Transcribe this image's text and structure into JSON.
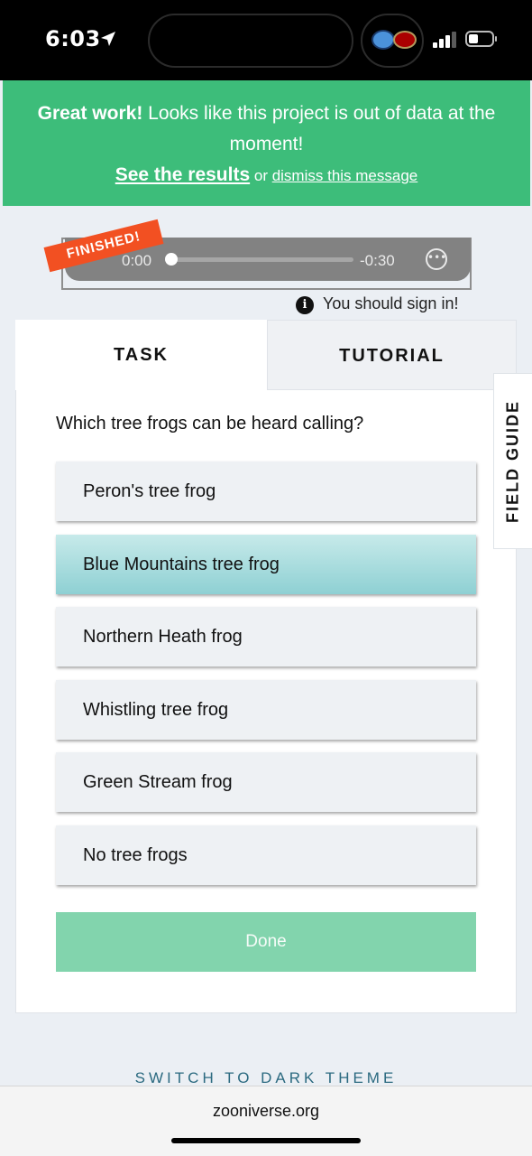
{
  "status_bar": {
    "time": "6:03"
  },
  "banner": {
    "bold_text": "Great work!",
    "message": " Looks like this project is out of data at the moment!",
    "results_link": "See the results",
    "or_text": " or ",
    "dismiss_link": "dismiss this message",
    "background_color": "#3dbd7a"
  },
  "audio_player": {
    "current_time": "0:00",
    "remaining_time": "-0:30",
    "progress": 0,
    "finished_badge": "FINISHED!"
  },
  "sign_in_notice": "You should sign in!",
  "tabs": [
    {
      "label": "TASK",
      "active": true
    },
    {
      "label": "TUTORIAL",
      "active": false
    }
  ],
  "task": {
    "question": "Which tree frogs can be heard calling?",
    "options": [
      {
        "label": "Peron's tree frog",
        "selected": false
      },
      {
        "label": "Blue Mountains tree frog",
        "selected": true
      },
      {
        "label": "Northern Heath frog",
        "selected": false
      },
      {
        "label": "Whistling tree frog",
        "selected": false
      },
      {
        "label": "Green Stream frog",
        "selected": false
      },
      {
        "label": "No tree frogs",
        "selected": false
      }
    ],
    "done_label": "Done"
  },
  "field_guide_label": "FIELD GUIDE",
  "theme_toggle_label": "SWITCH TO DARK THEME",
  "browser": {
    "url": "zooniverse.org"
  },
  "colors": {
    "accent_green": "#82d4ad",
    "selected_teal": "#8ed0d3",
    "finished_orange": "#f25022"
  }
}
